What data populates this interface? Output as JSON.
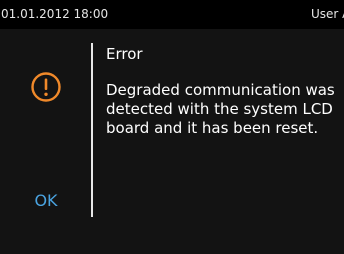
{
  "status_bar": {
    "datetime": "01.01.2012 18:00",
    "user": "User A"
  },
  "dialog": {
    "icon": "exclamation-circle-icon",
    "title": "Error",
    "message": "Degraded communication was detected with the system LCD board and it has been reset.",
    "ok_label": "OK"
  },
  "colors": {
    "accent_warning": "#f0892a",
    "ok_text": "#4aa3e0",
    "background": "#131313",
    "status_bar": "#000000"
  }
}
